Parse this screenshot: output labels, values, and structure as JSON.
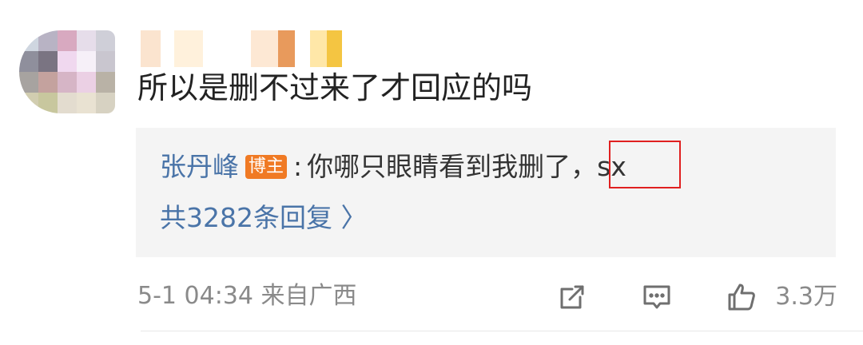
{
  "comment": {
    "text": "所以是删不过来了才回应的吗"
  },
  "reply": {
    "author": "张丹峰",
    "badge": "博主",
    "separator": ":",
    "text": "你哪只眼睛看到我删了，sx",
    "more_label": "共3282条回复 〉"
  },
  "meta": {
    "time_location": "5-1 04:34  来自广西"
  },
  "actions": {
    "like_count": "3.3万",
    "share_icon": "share-icon",
    "comment_icon": "comment-icon",
    "like_icon": "thumbs-up-icon"
  },
  "colors": {
    "link_blue": "#4a74a8",
    "badge_orange": "#f07a24",
    "highlight_red": "#e02020",
    "reply_bg": "#f4f4f4",
    "meta_gray": "#8a8a8a"
  }
}
